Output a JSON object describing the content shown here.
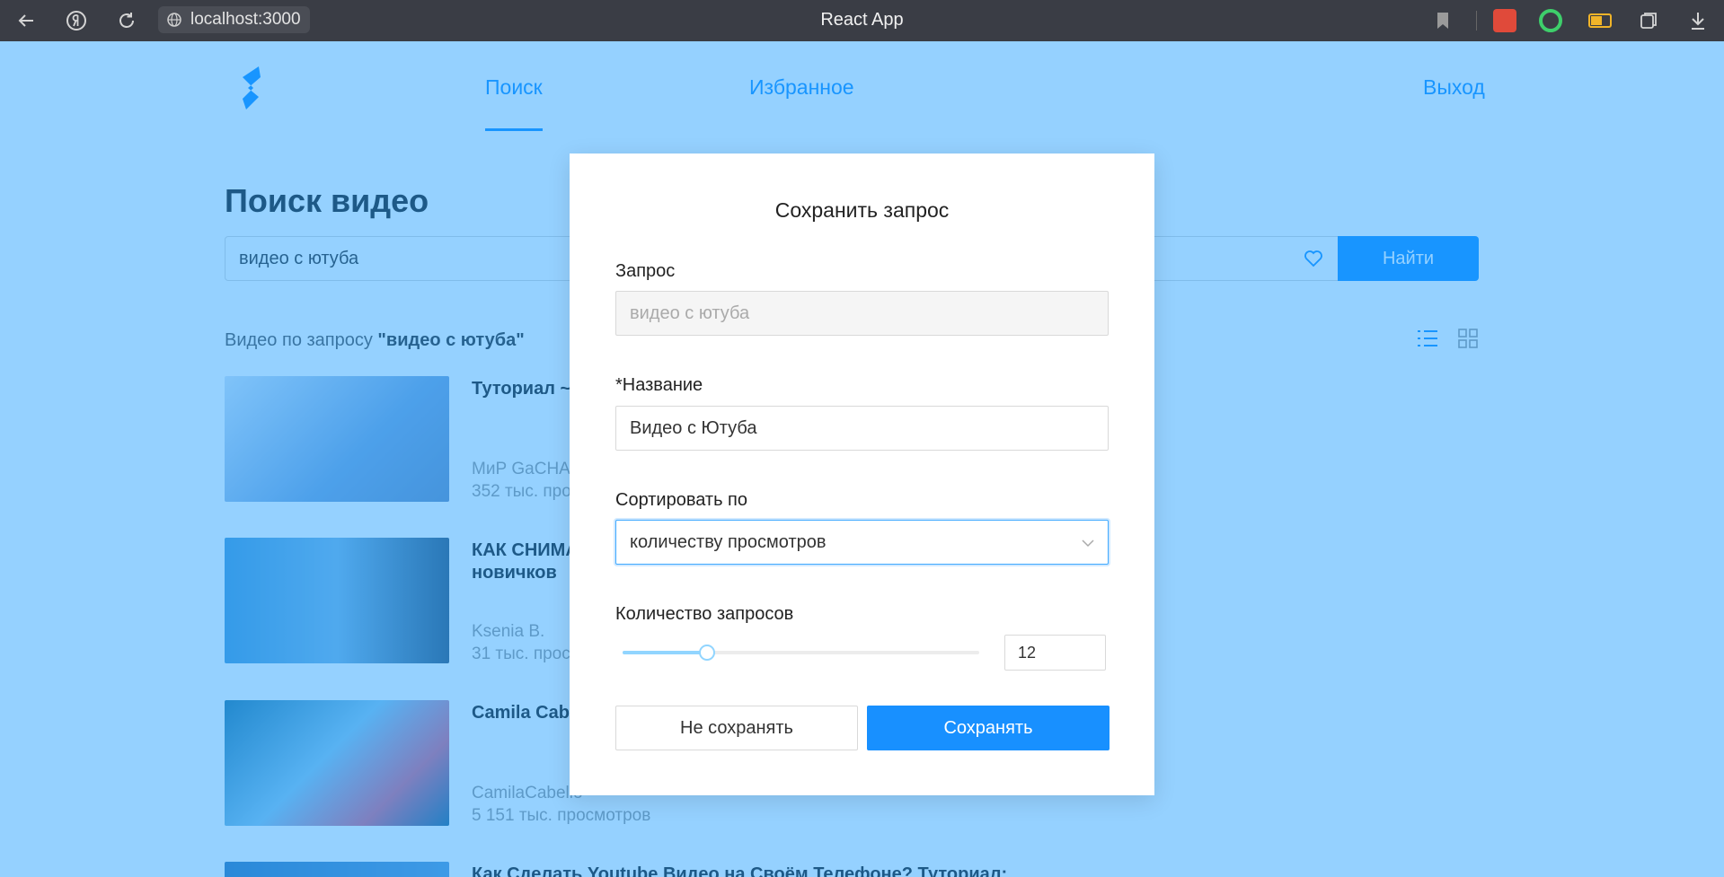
{
  "browser": {
    "url": "localhost:3000",
    "tab_title": "React App",
    "back_icon": "arrow-left-icon",
    "yandex_icon": "yandex-icon",
    "reload_icon": "reload-icon",
    "bookmark_icon": "bookmark-icon",
    "download_icon": "download-icon"
  },
  "nav": {
    "tabs": [
      {
        "label": "Поиск",
        "active": true
      },
      {
        "label": "Избранное",
        "active": false
      }
    ],
    "logout_label": "Выход"
  },
  "page": {
    "title": "Поиск видео",
    "search_value": "видео с ютуба",
    "find_label": "Найти",
    "results_prefix": "Видео по запросу ",
    "results_query": "\"видео с ютуба\""
  },
  "videos": [
    {
      "title": "Туториал ~",
      "channel": "МиР GaCHA",
      "views": "352 тыс. прос"
    },
    {
      "title": "КАК СНИМА",
      "title2": "новичков",
      "channel": "Ksenia B.",
      "views": "31 тыс. прос"
    },
    {
      "title": "Camila Cabe",
      "channel": "CamilaCabello",
      "views": "5 151 тыс. просмотров"
    },
    {
      "title": "Как Сделать Youtube Видео на Своём Телефоне? Туториал:"
    }
  ],
  "modal": {
    "title": "Сохранить запрос",
    "query_label": "Запрос",
    "query_value": "видео с ютуба",
    "name_label": "*Название",
    "name_value": "Видео с Ютуба",
    "sort_label": "Сортировать по",
    "sort_value": "количеству просмотров",
    "count_label": "Количество запросов",
    "count_value": "12",
    "slider_fraction": 0.24,
    "cancel_label": "Не сохранять",
    "save_label": "Сохранять"
  },
  "colors": {
    "accent": "#1890ff",
    "overlay": "rgba(24,154,255,0.46)",
    "chrome": "#3a3d45"
  }
}
